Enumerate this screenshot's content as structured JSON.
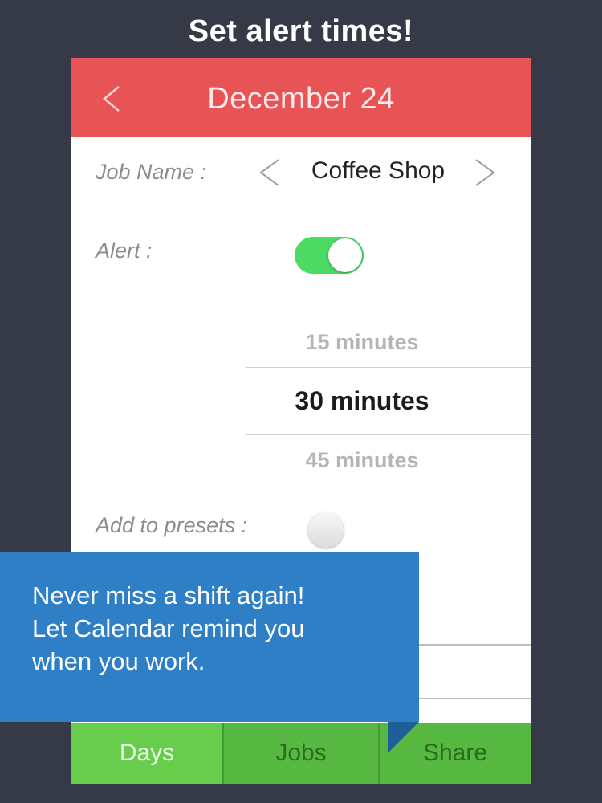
{
  "promo_title": "Set alert times!",
  "header": {
    "title": "December 24"
  },
  "form": {
    "job_name_label": "Job Name :",
    "job_name_value": "Coffee Shop",
    "alert_label": "Alert :",
    "alert_enabled": true,
    "presets_label": "Add to presets :",
    "presets_enabled": false
  },
  "picker": {
    "options": [
      "15 minutes",
      "30 minutes",
      "45 minutes"
    ],
    "selected": "30 minutes"
  },
  "callout": {
    "text": "Never miss a shift again!\nLet Calendar remind you\nwhen you work."
  },
  "tabs": [
    {
      "label": "Days",
      "active": true
    },
    {
      "label": "Jobs",
      "active": false
    },
    {
      "label": "Share",
      "active": false
    }
  ],
  "colors": {
    "background": "#363946",
    "header": "#e85356",
    "toggle_on": "#4cd964",
    "tabbar": "#56b840",
    "tab_active": "#68cc4c",
    "callout": "#2e7fc6"
  }
}
